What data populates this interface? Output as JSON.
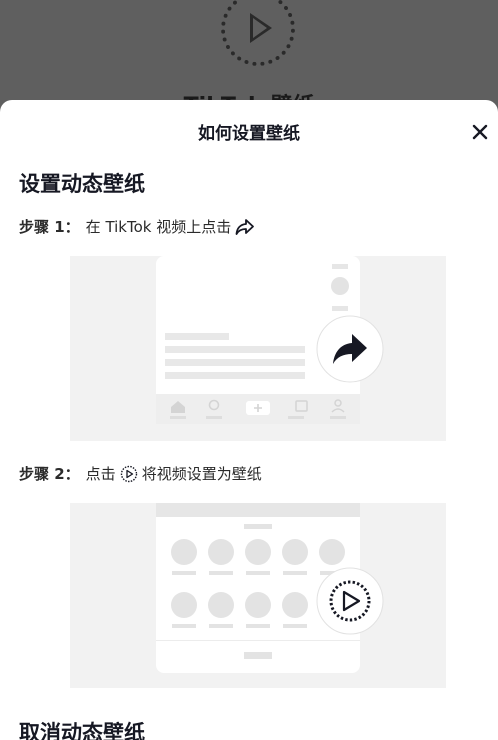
{
  "background": {
    "title": "TikTok 壁纸"
  },
  "sheet": {
    "title": "如何设置壁纸",
    "close_label": "×",
    "section1_title": "设置动态壁纸",
    "step1": {
      "label": "步骤 1：",
      "text": "在 TikTok 视频上点击",
      "icon": "share-arrow-icon"
    },
    "step2": {
      "label": "步骤 2：",
      "text_before": "点击",
      "text_after": "将视频设置为壁纸",
      "icon": "live-wallpaper-play-icon"
    },
    "section2_title": "取消动态壁纸"
  },
  "colors": {
    "sheet_bg": "#ffffff",
    "overlay": "#5f5f5f",
    "illustration_bg": "#f2f2f2",
    "text": "#161823"
  }
}
